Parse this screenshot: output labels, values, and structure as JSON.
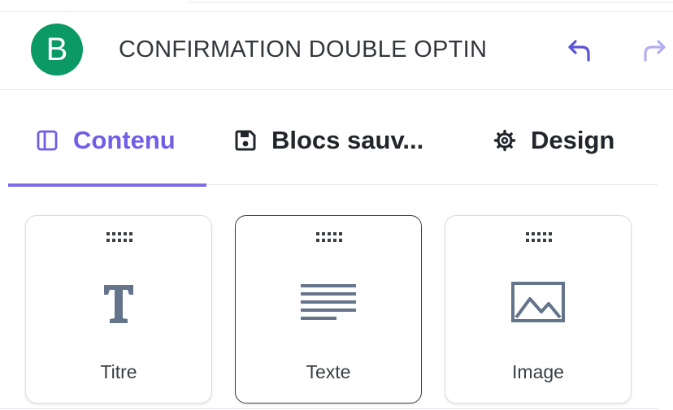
{
  "app": {
    "logo_letter": "B",
    "title": "CONFIRMATION DOUBLE OPTIN"
  },
  "toolbar": {
    "undo_icon": "undo-icon",
    "redo_icon": "redo-icon"
  },
  "tabs": [
    {
      "label": "Contenu",
      "icon": "columns-icon",
      "active": true
    },
    {
      "label": "Blocs sauv...",
      "icon": "floppy-disk-icon",
      "active": false
    },
    {
      "label": "Design",
      "icon": "gear-icon",
      "active": false
    }
  ],
  "blocks": [
    {
      "label": "Titre",
      "icon": "title-t-icon",
      "selected": false
    },
    {
      "label": "Texte",
      "icon": "text-lines-icon",
      "selected": true
    },
    {
      "label": "Image",
      "icon": "image-icon",
      "selected": false
    }
  ],
  "colors": {
    "brand_green": "#0b9966",
    "accent_purple": "#6f5ee6",
    "undo_active": "#5b54d8",
    "redo_disabled": "#b3aef0",
    "icon_gray": "#64748b"
  }
}
